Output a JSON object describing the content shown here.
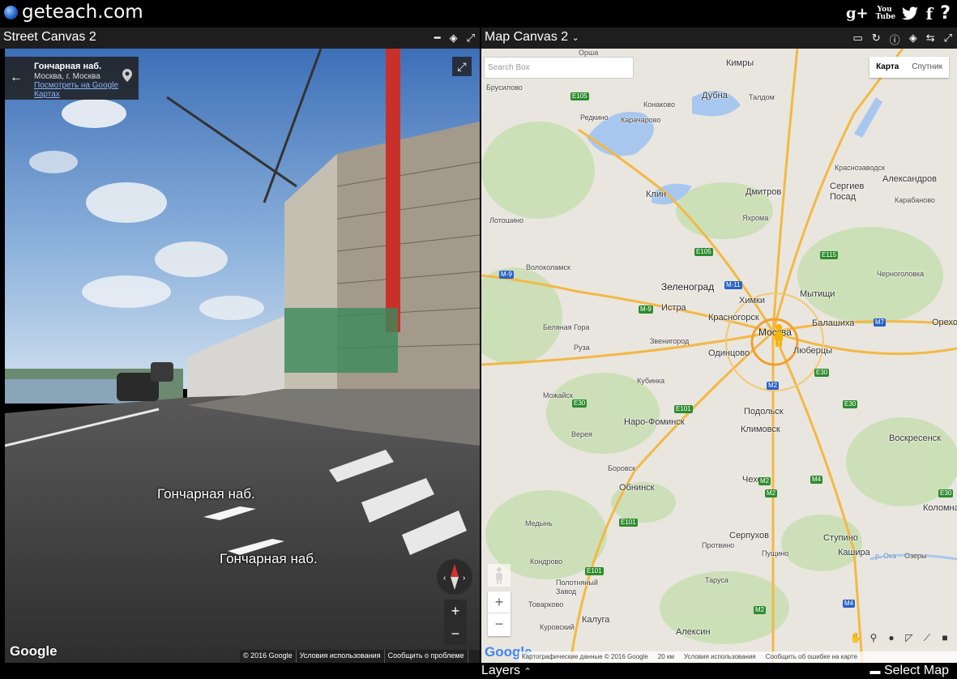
{
  "site": {
    "name": "geteach.com"
  },
  "social": [
    "g+",
    "You Tube",
    "twitter",
    "f",
    "?"
  ],
  "street_panel": {
    "title": "Street Canvas 2",
    "info": {
      "name": "Гончарная наб.",
      "city": "Москва, г. Москва",
      "link": "Посмотреть на Google Картах"
    },
    "road_label_1": "Гончарная наб.",
    "road_label_2": "Гончарная наб.",
    "zoom_in": "+",
    "zoom_out": "−",
    "google": "Google",
    "footer": [
      "© 2016 Google",
      "Условия использования",
      "Сообщить о проблеме"
    ]
  },
  "map_panel": {
    "title": "Map Canvas 2",
    "search_placeholder": "Search Box",
    "map_type": [
      "Карта",
      "Спутник"
    ],
    "cities": {
      "orsha": "Орша",
      "kimry": "Кимры",
      "dubna": "Дубна",
      "talдом": "Талдом",
      "konakovo": "Конаково",
      "karacharovo": "Карачарово",
      "redkino": "Редкино",
      "krasnozavodsk": "Краснозаводск",
      "aleksandrov": "Александров",
      "sergiev": "Сергиев Посад",
      "karabanovo": "Карабаново",
      "klin": "Клин",
      "dmitrov": "Дмитров",
      "yakhroma": "Яхрома",
      "lotoshino": "Лотошино",
      "volokolamsk": "Волоколамск",
      "zelenograd": "Зеленоград",
      "mytishchi": "Мытищи",
      "chernogolovka": "Черноголовка",
      "khimki": "Химки",
      "istra": "Истра",
      "krasnogorsk": "Красногорск",
      "moskva": "Москва",
      "balashikha": "Балашиха",
      "orekhovo": "Орехово",
      "belaya_gora": "Беляная Гора",
      "zvenigorod": "Звенигород",
      "odintsovo": "Одинцово",
      "lyubertsy": "Люберцы",
      "ruza": "Руза",
      "kubinka": "Кубинка",
      "mozhaysk": "Можайск",
      "podolsk": "Подольск",
      "naro": "Наро-Фоминск",
      "klimovsk": "Климовск",
      "vereya": "Верея",
      "voskresensk": "Воскресенск",
      "borovsk": "Боровск",
      "chekhov": "Чехов",
      "obninsk": "Обнинск",
      "kolomna": "Коломна",
      "medyn": "Медынь",
      "serpukhov": "Серпухов",
      "stupino": "Ступино",
      "protvino": "Протвино",
      "pushchino": "Пущино",
      "kashira": "Кашира",
      "oka": "р. Ока",
      "ozery": "Озеры",
      "kondrovo": "Кондрово",
      "tarusa": "Таруса",
      "polotnyany": "Полотняный Завод",
      "tovarkovo": "Товарково",
      "kaluga": "Калуга",
      "aleksin": "Алексин",
      "kurovskoy": "Куровский",
      "brusilovo": "Брусилово"
    },
    "shields": [
      "E105",
      "E105",
      "E115",
      "M-11",
      "M-9",
      "M-9",
      "M7",
      "E30",
      "E30",
      "E30",
      "E30",
      "E101",
      "E101",
      "E101",
      "M2",
      "M2",
      "M2",
      "M2",
      "M4",
      "M4",
      "E30"
    ],
    "zoom_in": "+",
    "zoom_out": "−",
    "google": "Google",
    "footer": [
      "Картографические данные © 2016 Google",
      "20 км",
      "Условия использования",
      "Сообщить об ошибке на карте"
    ]
  },
  "bottom": {
    "layers": "Layers",
    "select_map": "Select Map"
  }
}
